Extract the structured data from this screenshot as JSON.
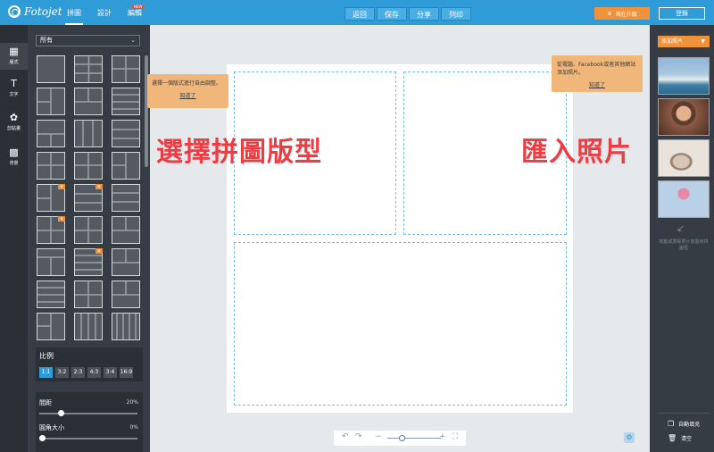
{
  "app": {
    "logo_text": "Fotojet"
  },
  "topnav": {
    "items": [
      "拼圖",
      "設計",
      "編輯"
    ],
    "new_badge": "NEW"
  },
  "toolbar": {
    "undo": "返回",
    "save": "保存",
    "share": "分享",
    "print": "列印"
  },
  "account": {
    "upgrade": "現在升級",
    "login": "登錄"
  },
  "leftrail": {
    "items": [
      {
        "label": "版式",
        "icon": "layout-icon"
      },
      {
        "label": "文字",
        "icon": "text-icon"
      },
      {
        "label": "剪貼畫",
        "icon": "clipart-icon"
      },
      {
        "label": "背景",
        "icon": "background-icon"
      }
    ]
  },
  "layouts": {
    "filter": "所有",
    "premium_icon": "crown-icon"
  },
  "ratio": {
    "title": "比例",
    "options": [
      "1:1",
      "3:2",
      "2:3",
      "4:3",
      "3:4",
      "16:9"
    ],
    "selected": "1:1"
  },
  "spacing": {
    "label": "間距",
    "value": "20%",
    "level": 0.2
  },
  "corner": {
    "label": "圓角大小",
    "value": "0%",
    "level": 0
  },
  "tips": {
    "left": {
      "text": "選擇一個版式進行自由調整。",
      "link": "知道了"
    },
    "right": {
      "text": "從電腦、Facebook或者其他網站添加照片。",
      "link": "知道了"
    }
  },
  "overlay": {
    "left": "選擇拼圖版型",
    "right": "匯入照片"
  },
  "rightpanel": {
    "add_photo": "添加照片",
    "hint": "拖動或雙擊照片放置到拼圖框",
    "autofill": "自動填充",
    "clear": "清空"
  },
  "colors": {
    "accent": "#2f9bd7",
    "orange": "#f0923b",
    "overlay_red": "#ef3b42",
    "panel": "#363c43"
  }
}
